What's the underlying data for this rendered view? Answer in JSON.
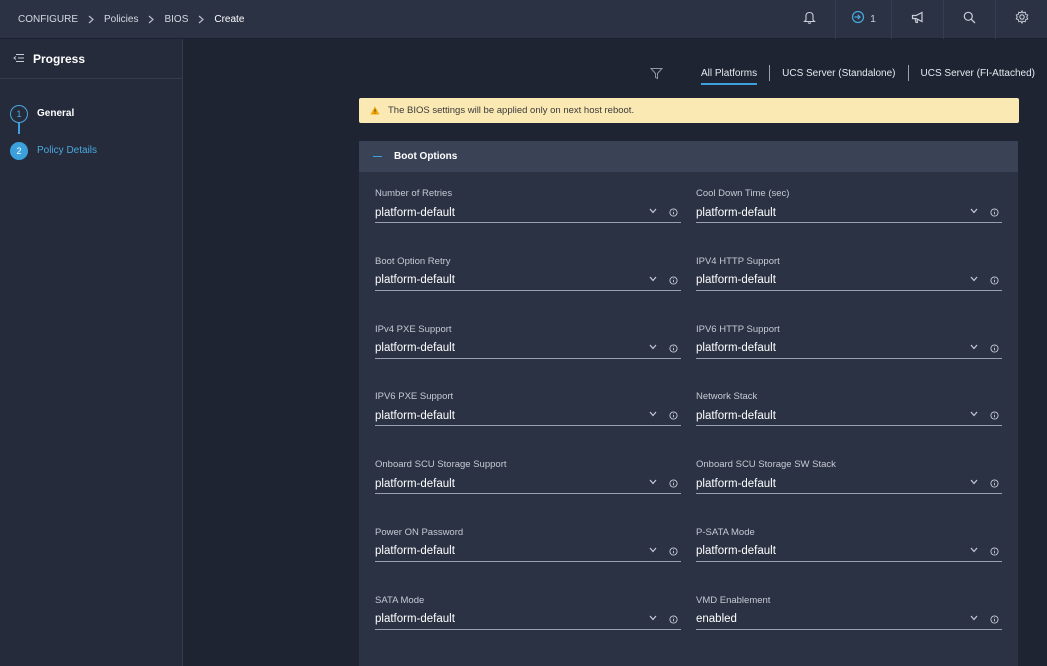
{
  "breadcrumb": {
    "items": [
      "CONFIGURE",
      "Policies",
      "BIOS",
      "Create"
    ]
  },
  "topbar": {
    "notifications_icon": "bell-icon",
    "requests_count": "1",
    "announcements_icon": "megaphone-icon",
    "search_icon": "search-icon",
    "settings_icon": "gear-icon"
  },
  "progress": {
    "title": "Progress",
    "steps": [
      {
        "number": "1",
        "label": "General"
      },
      {
        "number": "2",
        "label": "Policy Details"
      }
    ]
  },
  "filters": {
    "tabs": [
      "All Platforms",
      "UCS Server (Standalone)",
      "UCS Server (FI-Attached)"
    ],
    "active": "All Platforms"
  },
  "banner": {
    "text": "The BIOS settings will be applied only on next host reboot."
  },
  "section": {
    "title": "Boot Options",
    "fields": [
      {
        "label": "Number of Retries",
        "value": "platform-default"
      },
      {
        "label": "Cool Down Time (sec)",
        "value": "platform-default"
      },
      {
        "label": "Boot Option Retry",
        "value": "platform-default"
      },
      {
        "label": "IPV4 HTTP Support",
        "value": "platform-default"
      },
      {
        "label": "IPv4 PXE Support",
        "value": "platform-default"
      },
      {
        "label": "IPV6 HTTP Support",
        "value": "platform-default"
      },
      {
        "label": "IPV6 PXE Support",
        "value": "platform-default"
      },
      {
        "label": "Network Stack",
        "value": "platform-default"
      },
      {
        "label": "Onboard SCU Storage Support",
        "value": "platform-default"
      },
      {
        "label": "Onboard SCU Storage SW Stack",
        "value": "platform-default"
      },
      {
        "label": "Power ON Password",
        "value": "platform-default"
      },
      {
        "label": "P-SATA Mode",
        "value": "platform-default"
      },
      {
        "label": "SATA Mode",
        "value": "platform-default"
      },
      {
        "label": "VMD Enablement",
        "value": "enabled"
      }
    ]
  },
  "colors": {
    "accent": "#3ba0dc",
    "banner_bg": "#fbe9b4",
    "background": "#1f2433"
  }
}
